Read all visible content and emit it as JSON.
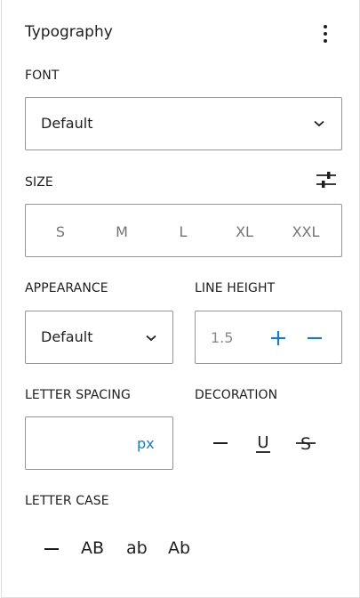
{
  "panel": {
    "title": "Typography",
    "menu_icon": "more-vertical-icon"
  },
  "font": {
    "label": "FONT",
    "value": "Default"
  },
  "size": {
    "label": "SIZE",
    "settings_icon": "sliders-icon",
    "options": [
      "S",
      "M",
      "L",
      "XL",
      "XXL"
    ]
  },
  "appearance": {
    "label": "APPEARANCE",
    "value": "Default"
  },
  "line_height": {
    "label": "LINE HEIGHT",
    "value": "1.5"
  },
  "letter_spacing": {
    "label": "LETTER SPACING",
    "value": "",
    "unit": "px"
  },
  "decoration": {
    "label": "DECORATION",
    "options": [
      "none",
      "underline",
      "strikethrough"
    ],
    "underline_glyph": "U",
    "strike_glyph": "S"
  },
  "letter_case": {
    "label": "LETTER CASE",
    "options": [
      "AB",
      "ab",
      "Ab"
    ]
  },
  "colors": {
    "accent": "#1a7bc4",
    "border": "#949494",
    "text": "#1e1e1e",
    "muted": "#757575"
  }
}
